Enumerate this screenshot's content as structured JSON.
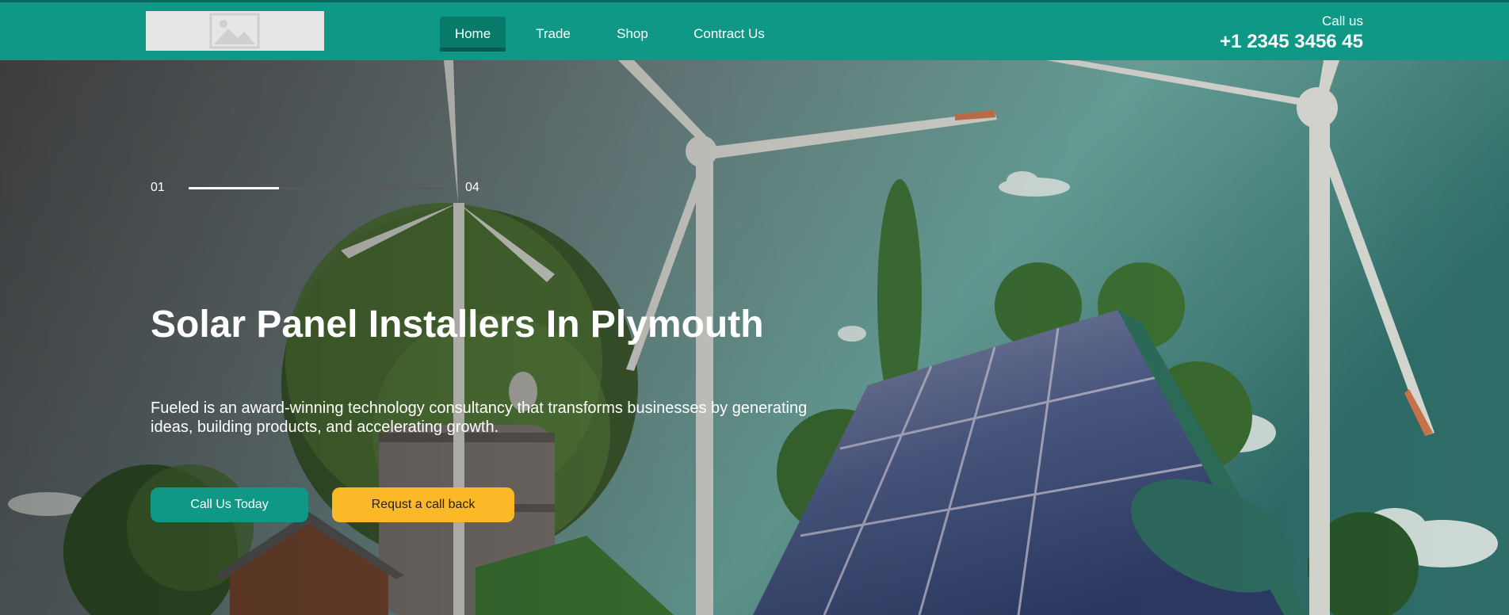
{
  "nav": {
    "items": [
      {
        "label": "Home",
        "active": true
      },
      {
        "label": "Trade",
        "active": false
      },
      {
        "label": "Shop",
        "active": false
      },
      {
        "label": "Contract Us",
        "active": false
      }
    ],
    "logo_icon": "image-placeholder-icon"
  },
  "contact": {
    "label": "Call us",
    "phone": "+1 2345 3456 45"
  },
  "slider": {
    "current": "01",
    "total": "04",
    "progress": 0.355
  },
  "hero": {
    "title": "Solar Panel Installers In Plymouth",
    "description": "Fueled is an award-winning technology consultancy that transforms businesses by generating ideas, building products, and accelerating growth.",
    "primary_button": "Call Us Today",
    "secondary_button": "Requst a call back"
  },
  "colors": {
    "brand": "#0e9885",
    "accent": "#fbb827"
  }
}
